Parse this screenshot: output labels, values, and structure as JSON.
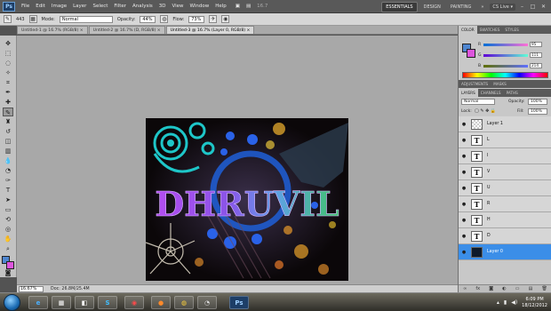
{
  "app": {
    "logo": "Ps"
  },
  "menu": [
    "File",
    "Edit",
    "Image",
    "Layer",
    "Select",
    "Filter",
    "Analysis",
    "3D",
    "View",
    "Window",
    "Help"
  ],
  "menu_right": {
    "essentials": "ESSENTIALS",
    "design": "DESIGN",
    "painting": "PAINTING",
    "more": "»",
    "cs_live": "CS Live ▾",
    "zoom_level": "16.7"
  },
  "options": {
    "mode_label": "Mode:",
    "mode_value": "Normal",
    "opacity_label": "Opacity:",
    "opacity_value": "44%",
    "flow_label": "Flow:",
    "flow_value": "73%",
    "brush_size": "443"
  },
  "tabs": [
    "Untitled-1 @ 16.7% (RGB/8) ×",
    "Untitled-2 @ 16.7% (D, RGB/8) ×",
    "Untitled-3 @ 16.7% (Layer 0, RGB/8) ×"
  ],
  "status": {
    "zoom": "16.67%",
    "doc": "Doc: 26.8M/25.4M"
  },
  "artwork": {
    "title": "DHRUVIL"
  },
  "color_panel": {
    "tabs": [
      "COLOR",
      "SWATCHES",
      "STYLES"
    ],
    "rows": [
      {
        "label": "R",
        "value": "95"
      },
      {
        "label": "G",
        "value": "111"
      },
      {
        "label": "B",
        "value": "214"
      }
    ],
    "fg_color": "#4f86d0",
    "bg_color": "#dd55dd"
  },
  "adjust_tabs": [
    "ADJUSTMENTS",
    "MASKS"
  ],
  "layers_panel": {
    "tabs": [
      "LAYERS",
      "CHANNELS",
      "PATHS"
    ],
    "blend_mode": "Normal",
    "opacity_label": "Opacity:",
    "opacity_value": "100%",
    "lock_label": "Lock:",
    "fill_label": "Fill:",
    "fill_value": "100%",
    "layers": [
      {
        "name": "Layer 1",
        "thumb": ""
      },
      {
        "name": "L",
        "thumb": "T"
      },
      {
        "name": "I",
        "thumb": "T"
      },
      {
        "name": "V",
        "thumb": "T"
      },
      {
        "name": "U",
        "thumb": "T"
      },
      {
        "name": "R",
        "thumb": "T"
      },
      {
        "name": "H",
        "thumb": "T"
      },
      {
        "name": "D",
        "thumb": "T"
      },
      {
        "name": "Layer 0",
        "thumb": ""
      }
    ],
    "footer_icons": [
      "∞",
      "fx",
      "◙",
      "◐",
      "▭",
      "▤",
      "🗑"
    ]
  },
  "taskbar": {
    "apps": [
      "e",
      "▦",
      "◧",
      "S",
      "◉",
      "●",
      "◍",
      "◔",
      "Ps"
    ],
    "time": "6:09 PM",
    "date": "18/12/2012"
  }
}
